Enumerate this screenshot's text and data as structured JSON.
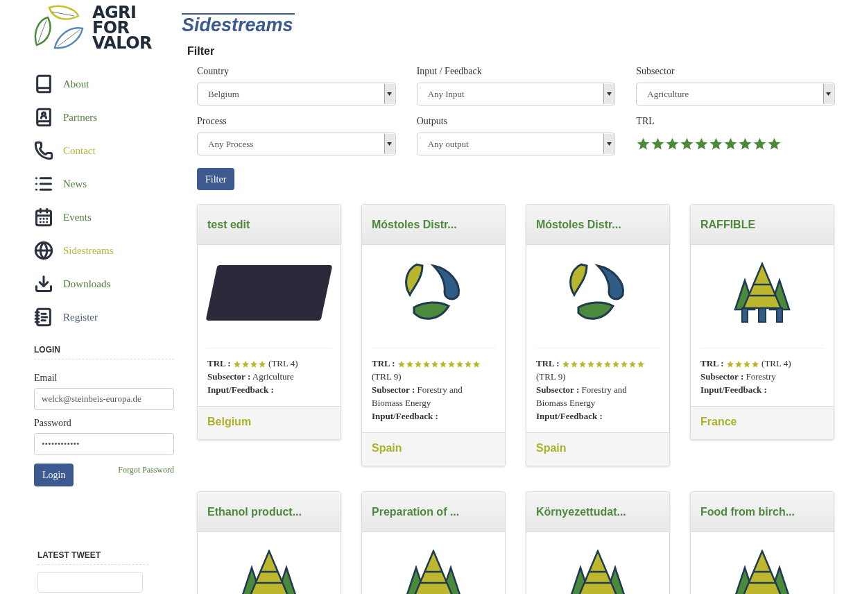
{
  "logo": {
    "lines": [
      "AGRI",
      "FOR",
      "VALOR"
    ]
  },
  "nav": [
    {
      "label": "About",
      "kind": "book",
      "color": "#4f7f3f"
    },
    {
      "label": "Partners",
      "kind": "contacts",
      "color": "#4f7f3f"
    },
    {
      "label": "Contact",
      "kind": "phone",
      "color": "#b3b63a"
    },
    {
      "label": "News",
      "kind": "list",
      "color": "#4f7f3f"
    },
    {
      "label": "Events",
      "kind": "calendar",
      "color": "#4f7f3f"
    },
    {
      "label": "Sidestreams",
      "kind": "globe",
      "color": "#b3b63a"
    },
    {
      "label": "Downloads",
      "kind": "download",
      "color": "#4f7f3f"
    },
    {
      "label": "Register",
      "kind": "notebook",
      "color": "#4b5a7a"
    }
  ],
  "login": {
    "heading": "LOGIN",
    "email_label": "Email",
    "email_value": "welck@steinbeis-europa.de",
    "password_label": "Password",
    "password_value": "••••••••••••",
    "button": "Login",
    "forgot": "Forgot Password"
  },
  "latest_tweet": {
    "heading": "LATEST TWEET"
  },
  "page_title": "Sidestreams",
  "filter": {
    "heading": "Filter",
    "fields": [
      {
        "label": "Country",
        "value": "Belgium",
        "kind": "select"
      },
      {
        "label": "Input / Feedback",
        "value": "Any Input",
        "kind": "select"
      },
      {
        "label": "Subsector",
        "value": "Agriculture",
        "kind": "select"
      },
      {
        "label": "Process",
        "value": "Any Process",
        "kind": "select"
      },
      {
        "label": "Outputs",
        "value": "Any output",
        "kind": "select"
      },
      {
        "label": "TRL",
        "stars": 10,
        "kind": "stars"
      }
    ],
    "button": "Filter"
  },
  "cards": [
    {
      "title": "test edit",
      "kind": "photo",
      "trl_label": "TRL :",
      "stars": 4,
      "trl_value": "(TRL 4)",
      "subsector": "**Subsector :** Agriculture",
      "input_label": "Input/Feedback :",
      "country": "Belgium"
    },
    {
      "title": "Móstoles Distr...",
      "kind": "cycle",
      "trl_label": "TRL :",
      "stars": 10,
      "trl_value": "(TRL 9)",
      "subsector": "**Subsector :** Forestry and Biomass Energy",
      "input_label": "Input/Feedback :",
      "country": "Spain"
    },
    {
      "title": "Móstoles Distr...",
      "kind": "cycle",
      "trl_label": "TRL :",
      "stars": 10,
      "trl_value": "(TRL 9)",
      "subsector": "**Subsector :** Forestry and Biomass Energy",
      "input_label": "Input/Feedback :",
      "country": "Spain"
    },
    {
      "title": "RAFFIBLE",
      "kind": "trees",
      "trl_label": "TRL :",
      "stars": 4,
      "trl_value": "(TRL 4)",
      "subsector": "**Subsector :** Forestry",
      "input_label": "Input/Feedback :",
      "country": "France"
    },
    {
      "title": "Ethanol product...",
      "kind": "trees"
    },
    {
      "title": "Preparation of ...",
      "kind": "trees"
    },
    {
      "title": "Környezettudat...",
      "kind": "trees"
    },
    {
      "title": "Food from birch...",
      "kind": "trees"
    }
  ]
}
